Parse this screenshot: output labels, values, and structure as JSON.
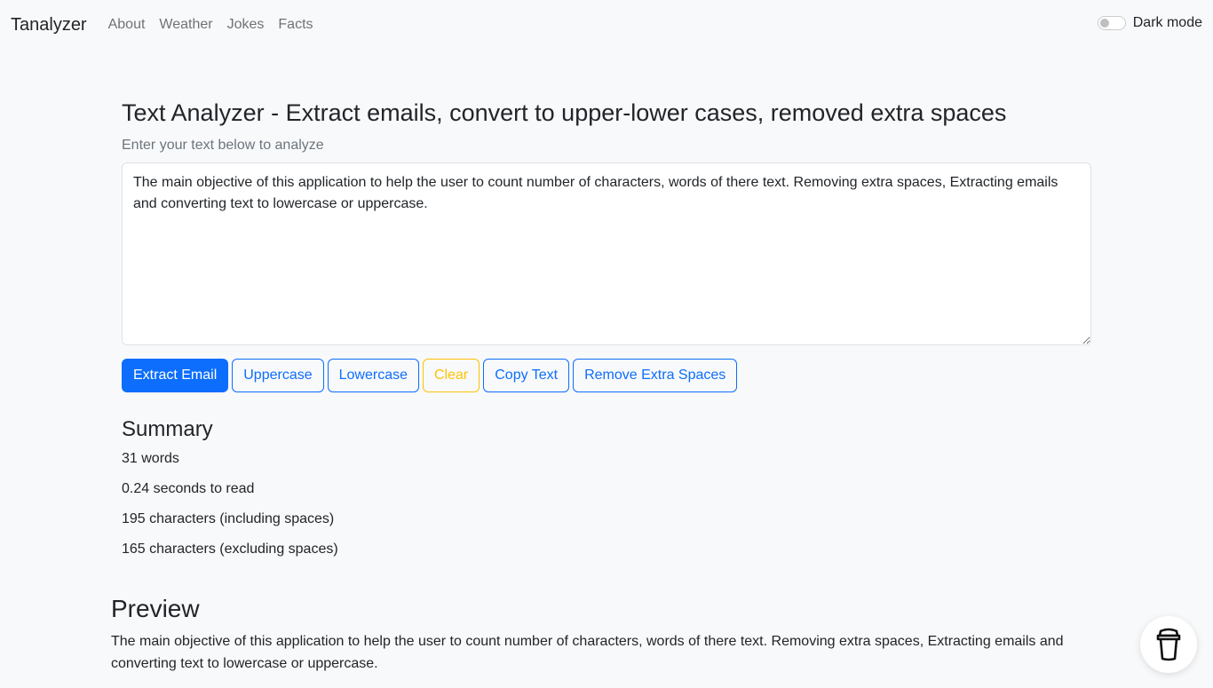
{
  "nav": {
    "brand": "Tanalyzer",
    "links": [
      "About",
      "Weather",
      "Jokes",
      "Facts"
    ],
    "dark_mode_label": "Dark mode",
    "dark_mode_on": false
  },
  "main": {
    "title": "Text Analyzer - Extract emails, convert to upper-lower cases, removed extra spaces",
    "hint": "Enter your text below to analyze",
    "text": "The main objective of this application to help the user to count number of characters, words of there text. Removing extra spaces, Extracting emails and converting text to lowercase or uppercase.",
    "buttons": [
      "Extract Email",
      "Uppercase",
      "Lowercase",
      "Clear",
      "Copy Text",
      "Remove Extra Spaces"
    ]
  },
  "summary": {
    "title": "Summary",
    "words": "31 words",
    "read_time": "0.24 seconds to read",
    "chars_incl": "195 characters (including spaces)",
    "chars_excl": "165 characters (excluding spaces)"
  },
  "preview": {
    "title": "Preview",
    "text": "The main objective of this application to help the user to count number of characters, words of there text. Removing extra spaces, Extracting emails and converting text to lowercase or uppercase."
  },
  "colors": {
    "primary": "#0d6efd",
    "warning": "#ffc107",
    "background": "#f8f9fa"
  },
  "widget": {
    "icon": "coffee-cup-icon"
  }
}
